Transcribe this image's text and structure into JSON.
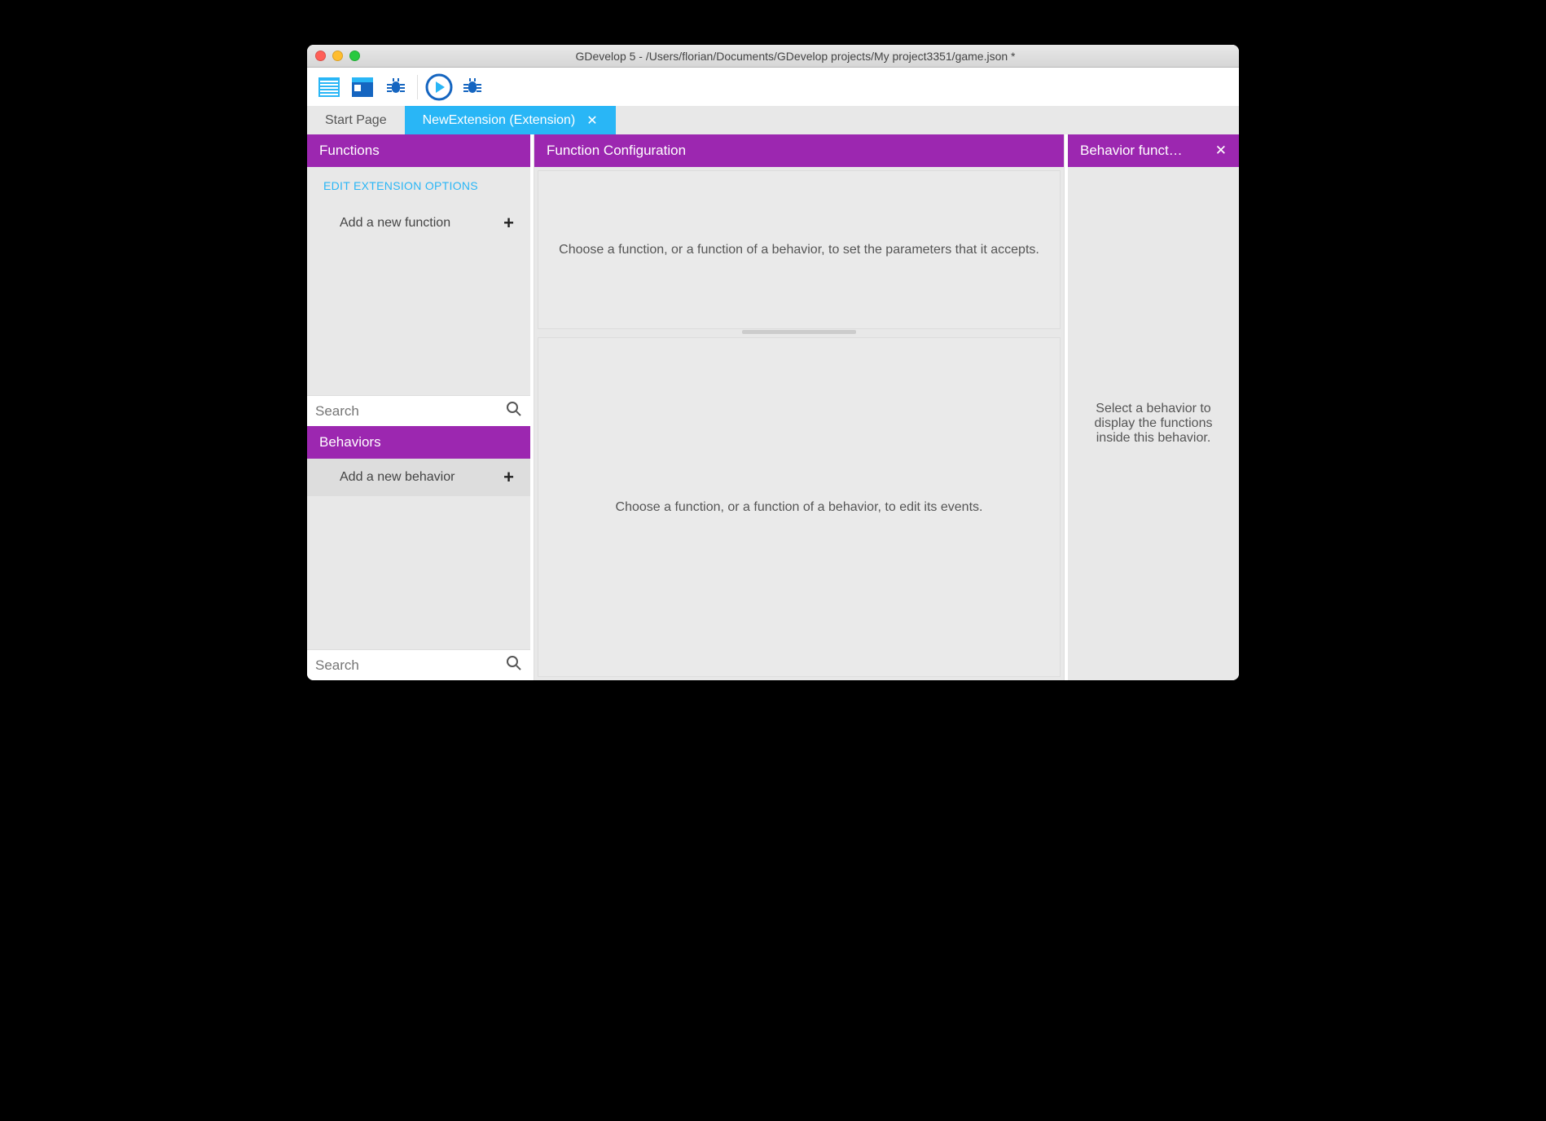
{
  "window": {
    "title": "GDevelop 5 - /Users/florian/Documents/GDevelop projects/My project3351/game.json *"
  },
  "colors": {
    "accent_purple": "#9c27b0",
    "accent_blue": "#29b6f6",
    "accent_navy": "#1565c0"
  },
  "tabs": [
    {
      "label": "Start Page",
      "active": false,
      "closable": false
    },
    {
      "label": "NewExtension (Extension)",
      "active": true,
      "closable": true
    }
  ],
  "left": {
    "functions_header": "Functions",
    "edit_options": "EDIT EXTENSION OPTIONS",
    "add_function": "Add a new function",
    "behaviors_header": "Behaviors",
    "add_behavior": "Add a new behavior",
    "search_placeholder_top": "Search",
    "search_placeholder_bottom": "Search"
  },
  "mid": {
    "config_header": "Function Configuration",
    "config_placeholder": "Choose a function, or a function of a behavior, to set the parameters that it accepts.",
    "events_placeholder": "Choose a function, or a function of a behavior, to edit its events."
  },
  "right": {
    "header": "Behavior funct…",
    "placeholder": "Select a behavior to display the functions inside this behavior."
  }
}
